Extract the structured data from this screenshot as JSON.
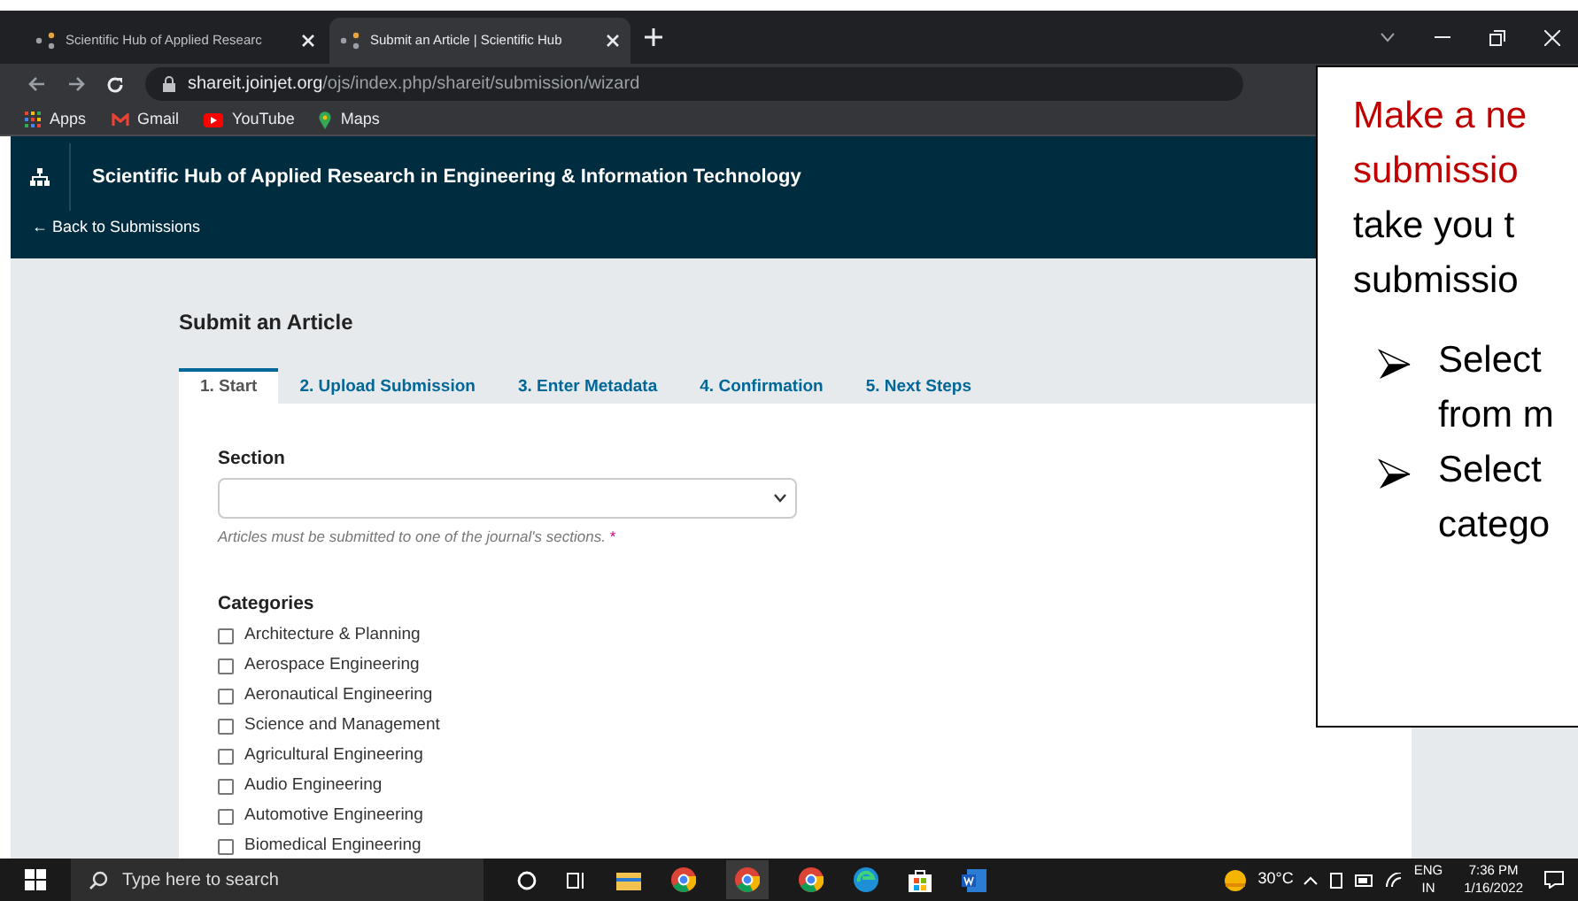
{
  "browser": {
    "tabs": [
      {
        "title": "Scientific Hub of Applied Researc",
        "selected": false
      },
      {
        "title": "Submit an Article | Scientific Hub",
        "selected": true
      }
    ],
    "url_host": "shareit.joinjet.org",
    "url_path": "/ojs/index.php/shareit/submission/wizard",
    "bookmarks": [
      "Apps",
      "Gmail",
      "YouTube",
      "Maps"
    ]
  },
  "site": {
    "title": "Scientific Hub of Applied Research in Engineering & Information Technology",
    "back_link": "← Back to Submissions"
  },
  "page": {
    "heading": "Submit an Article",
    "steps": [
      {
        "label": "1. Start",
        "selected": true
      },
      {
        "label": "2. Upload Submission",
        "selected": false
      },
      {
        "label": "3. Enter Metadata",
        "selected": false
      },
      {
        "label": "4. Confirmation",
        "selected": false
      },
      {
        "label": "5. Next Steps",
        "selected": false
      }
    ],
    "section": {
      "label": "Section",
      "help": "Articles must be submitted to one of the journal's sections.",
      "required_mark": "*"
    },
    "categories": {
      "label": "Categories",
      "items": [
        {
          "label": "Architecture & Planning",
          "checked": false
        },
        {
          "label": "Aerospace Engineering",
          "checked": false
        },
        {
          "label": "Aeronautical Engineering",
          "checked": false
        },
        {
          "label": "Science and Management",
          "checked": false
        },
        {
          "label": "Agricultural Engineering",
          "checked": false
        },
        {
          "label": "Audio Engineering",
          "checked": false
        },
        {
          "label": "Automotive Engineering",
          "checked": false
        },
        {
          "label": "Biomedical Engineering",
          "checked": false
        }
      ]
    }
  },
  "callout": {
    "heading_lines": [
      "Make a ne",
      "submissio"
    ],
    "body_lines": [
      "take you t",
      "submissio"
    ],
    "bullets": [
      [
        "Select",
        "from m"
      ],
      [
        "Select",
        "catego"
      ]
    ]
  },
  "taskbar": {
    "search_placeholder": "Type here to search",
    "temperature": "30°C",
    "language": "ENG",
    "region": "IN",
    "time": "7:36 PM",
    "date": "1/16/2022"
  }
}
